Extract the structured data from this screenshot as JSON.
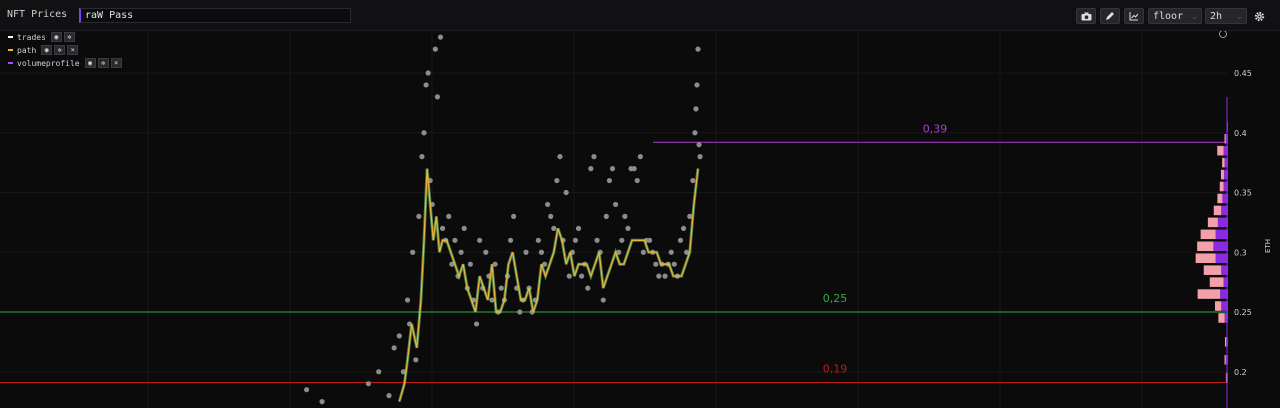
{
  "header": {
    "app_title": "NFT Prices",
    "search_value": "raW Pass",
    "metric_select": "floor",
    "interval_select": "2h",
    "icons": [
      "camera-icon",
      "pencil-icon",
      "chart-line-icon",
      "gear-icon"
    ]
  },
  "legend": [
    {
      "label": "trades",
      "color": "#ffffff",
      "controls": [
        "eye-icon",
        "gear-icon"
      ]
    },
    {
      "label": "path",
      "color": "#e8b43a",
      "controls": [
        "eye-icon",
        "gear-icon",
        "close-icon"
      ]
    },
    {
      "label": "volumeprofile",
      "color": "#a24bff",
      "controls": [
        "eye-icon",
        "gear-icon",
        "close-icon"
      ]
    }
  ],
  "colors": {
    "background": "#0b0b0c",
    "trades": "#8c8c8c",
    "path_line": "#e8b43a",
    "path_glow": "#6fbf6f",
    "level_039": "#b03bd0",
    "level_025": "#2fae3b",
    "level_019": "#c01a1a",
    "profile_buy": "#8a2be2",
    "profile_sell": "#f4a0a8"
  },
  "chart_data": {
    "type": "scatter",
    "y_unit": "ETH",
    "ylim": [
      0.17,
      0.48
    ],
    "y_ticks": [
      0.2,
      0.25,
      0.3,
      0.35,
      0.4,
      0.45
    ],
    "grid": true,
    "x_labels": [],
    "horizontal_levels": [
      {
        "label": "0,39",
        "value": 0.392,
        "color": "#b03bd0",
        "start_fraction": 0.51
      },
      {
        "label": "0,25",
        "value": 0.25,
        "color": "#2fae3b",
        "start_fraction": 0.0
      },
      {
        "label": "0,19",
        "value": 0.191,
        "color": "#c01a1a",
        "start_fraction": 0.0
      }
    ],
    "path": [
      [
        0.31,
        0.175
      ],
      [
        0.315,
        0.19
      ],
      [
        0.318,
        0.21
      ],
      [
        0.322,
        0.24
      ],
      [
        0.327,
        0.22
      ],
      [
        0.331,
        0.26
      ],
      [
        0.334,
        0.31
      ],
      [
        0.337,
        0.37
      ],
      [
        0.34,
        0.34
      ],
      [
        0.343,
        0.31
      ],
      [
        0.346,
        0.33
      ],
      [
        0.349,
        0.3
      ],
      [
        0.352,
        0.31
      ],
      [
        0.356,
        0.31
      ],
      [
        0.36,
        0.3
      ],
      [
        0.364,
        0.29
      ],
      [
        0.368,
        0.28
      ],
      [
        0.372,
        0.29
      ],
      [
        0.376,
        0.27
      ],
      [
        0.38,
        0.26
      ],
      [
        0.384,
        0.25
      ],
      [
        0.388,
        0.28
      ],
      [
        0.392,
        0.27
      ],
      [
        0.396,
        0.26
      ],
      [
        0.4,
        0.29
      ],
      [
        0.404,
        0.25
      ],
      [
        0.408,
        0.25
      ],
      [
        0.412,
        0.26
      ],
      [
        0.416,
        0.29
      ],
      [
        0.42,
        0.3
      ],
      [
        0.424,
        0.28
      ],
      [
        0.428,
        0.26
      ],
      [
        0.432,
        0.26
      ],
      [
        0.436,
        0.27
      ],
      [
        0.44,
        0.25
      ],
      [
        0.444,
        0.26
      ],
      [
        0.448,
        0.29
      ],
      [
        0.452,
        0.28
      ],
      [
        0.456,
        0.29
      ],
      [
        0.46,
        0.3
      ],
      [
        0.464,
        0.32
      ],
      [
        0.468,
        0.31
      ],
      [
        0.472,
        0.29
      ],
      [
        0.476,
        0.3
      ],
      [
        0.48,
        0.28
      ],
      [
        0.484,
        0.29
      ],
      [
        0.488,
        0.29
      ],
      [
        0.492,
        0.29
      ],
      [
        0.496,
        0.28
      ],
      [
        0.5,
        0.29
      ],
      [
        0.504,
        0.3
      ],
      [
        0.508,
        0.27
      ],
      [
        0.512,
        0.28
      ],
      [
        0.516,
        0.29
      ],
      [
        0.52,
        0.3
      ],
      [
        0.524,
        0.29
      ],
      [
        0.528,
        0.29
      ],
      [
        0.532,
        0.3
      ],
      [
        0.536,
        0.31
      ],
      [
        0.54,
        0.31
      ],
      [
        0.544,
        0.31
      ],
      [
        0.548,
        0.31
      ],
      [
        0.552,
        0.3
      ],
      [
        0.556,
        0.3
      ],
      [
        0.56,
        0.3
      ],
      [
        0.564,
        0.29
      ],
      [
        0.568,
        0.29
      ],
      [
        0.572,
        0.29
      ],
      [
        0.576,
        0.28
      ],
      [
        0.58,
        0.28
      ],
      [
        0.584,
        0.28
      ],
      [
        0.588,
        0.29
      ],
      [
        0.592,
        0.3
      ],
      [
        0.596,
        0.34
      ],
      [
        0.6,
        0.37
      ]
    ],
    "trades": [
      [
        0.22,
        0.185
      ],
      [
        0.235,
        0.175
      ],
      [
        0.28,
        0.19
      ],
      [
        0.29,
        0.2
      ],
      [
        0.3,
        0.18
      ],
      [
        0.305,
        0.22
      ],
      [
        0.31,
        0.23
      ],
      [
        0.314,
        0.2
      ],
      [
        0.318,
        0.26
      ],
      [
        0.32,
        0.24
      ],
      [
        0.323,
        0.3
      ],
      [
        0.326,
        0.21
      ],
      [
        0.329,
        0.33
      ],
      [
        0.332,
        0.38
      ],
      [
        0.334,
        0.4
      ],
      [
        0.336,
        0.44
      ],
      [
        0.338,
        0.45
      ],
      [
        0.34,
        0.36
      ],
      [
        0.342,
        0.34
      ],
      [
        0.345,
        0.47
      ],
      [
        0.347,
        0.43
      ],
      [
        0.35,
        0.48
      ],
      [
        0.352,
        0.32
      ],
      [
        0.355,
        0.31
      ],
      [
        0.358,
        0.33
      ],
      [
        0.361,
        0.29
      ],
      [
        0.364,
        0.31
      ],
      [
        0.367,
        0.28
      ],
      [
        0.37,
        0.3
      ],
      [
        0.373,
        0.32
      ],
      [
        0.376,
        0.27
      ],
      [
        0.379,
        0.29
      ],
      [
        0.382,
        0.26
      ],
      [
        0.385,
        0.24
      ],
      [
        0.388,
        0.31
      ],
      [
        0.391,
        0.27
      ],
      [
        0.394,
        0.3
      ],
      [
        0.397,
        0.28
      ],
      [
        0.4,
        0.26
      ],
      [
        0.403,
        0.29
      ],
      [
        0.406,
        0.25
      ],
      [
        0.409,
        0.27
      ],
      [
        0.412,
        0.26
      ],
      [
        0.415,
        0.28
      ],
      [
        0.418,
        0.31
      ],
      [
        0.421,
        0.33
      ],
      [
        0.424,
        0.27
      ],
      [
        0.427,
        0.25
      ],
      [
        0.43,
        0.26
      ],
      [
        0.433,
        0.3
      ],
      [
        0.436,
        0.27
      ],
      [
        0.439,
        0.25
      ],
      [
        0.442,
        0.26
      ],
      [
        0.445,
        0.31
      ],
      [
        0.448,
        0.3
      ],
      [
        0.451,
        0.29
      ],
      [
        0.454,
        0.34
      ],
      [
        0.457,
        0.33
      ],
      [
        0.46,
        0.32
      ],
      [
        0.463,
        0.36
      ],
      [
        0.466,
        0.38
      ],
      [
        0.469,
        0.31
      ],
      [
        0.472,
        0.35
      ],
      [
        0.475,
        0.28
      ],
      [
        0.478,
        0.3
      ],
      [
        0.481,
        0.31
      ],
      [
        0.484,
        0.32
      ],
      [
        0.487,
        0.28
      ],
      [
        0.49,
        0.29
      ],
      [
        0.493,
        0.27
      ],
      [
        0.496,
        0.37
      ],
      [
        0.499,
        0.38
      ],
      [
        0.502,
        0.31
      ],
      [
        0.505,
        0.3
      ],
      [
        0.508,
        0.26
      ],
      [
        0.511,
        0.33
      ],
      [
        0.514,
        0.36
      ],
      [
        0.517,
        0.37
      ],
      [
        0.52,
        0.34
      ],
      [
        0.523,
        0.3
      ],
      [
        0.526,
        0.31
      ],
      [
        0.529,
        0.33
      ],
      [
        0.532,
        0.32
      ],
      [
        0.535,
        0.37
      ],
      [
        0.538,
        0.37
      ],
      [
        0.541,
        0.36
      ],
      [
        0.544,
        0.38
      ],
      [
        0.547,
        0.3
      ],
      [
        0.55,
        0.31
      ],
      [
        0.553,
        0.31
      ],
      [
        0.556,
        0.3
      ],
      [
        0.559,
        0.29
      ],
      [
        0.562,
        0.28
      ],
      [
        0.565,
        0.29
      ],
      [
        0.568,
        0.28
      ],
      [
        0.571,
        0.29
      ],
      [
        0.574,
        0.3
      ],
      [
        0.577,
        0.29
      ],
      [
        0.58,
        0.28
      ],
      [
        0.583,
        0.31
      ],
      [
        0.586,
        0.32
      ],
      [
        0.589,
        0.3
      ],
      [
        0.592,
        0.33
      ],
      [
        0.595,
        0.36
      ],
      [
        0.597,
        0.4
      ],
      [
        0.598,
        0.42
      ],
      [
        0.599,
        0.44
      ],
      [
        0.6,
        0.47
      ],
      [
        0.601,
        0.39
      ],
      [
        0.602,
        0.38
      ]
    ],
    "volume_profile": [
      {
        "price": 0.255,
        "buy": 0.3,
        "sell": 0.25
      },
      {
        "price": 0.265,
        "buy": 0.35,
        "sell": 0.9
      },
      {
        "price": 0.275,
        "buy": 0.2,
        "sell": 0.55
      },
      {
        "price": 0.285,
        "buy": 0.3,
        "sell": 0.7
      },
      {
        "price": 0.295,
        "buy": 0.55,
        "sell": 0.8
      },
      {
        "price": 0.305,
        "buy": 0.65,
        "sell": 0.65
      },
      {
        "price": 0.315,
        "buy": 0.55,
        "sell": 0.6
      },
      {
        "price": 0.325,
        "buy": 0.45,
        "sell": 0.4
      },
      {
        "price": 0.335,
        "buy": 0.3,
        "sell": 0.3
      },
      {
        "price": 0.345,
        "buy": 0.25,
        "sell": 0.2
      },
      {
        "price": 0.355,
        "buy": 0.2,
        "sell": 0.15
      },
      {
        "price": 0.365,
        "buy": 0.18,
        "sell": 0.12
      },
      {
        "price": 0.375,
        "buy": 0.15,
        "sell": 0.1
      },
      {
        "price": 0.385,
        "buy": 0.2,
        "sell": 0.25
      },
      {
        "price": 0.395,
        "buy": 0.1,
        "sell": 0.05
      },
      {
        "price": 0.405,
        "buy": 0.05,
        "sell": 0.0
      },
      {
        "price": 0.225,
        "buy": 0.08,
        "sell": 0.05
      },
      {
        "price": 0.21,
        "buy": 0.1,
        "sell": 0.05
      },
      {
        "price": 0.195,
        "buy": 0.06,
        "sell": 0.03
      },
      {
        "price": 0.245,
        "buy": 0.15,
        "sell": 0.25
      }
    ]
  }
}
